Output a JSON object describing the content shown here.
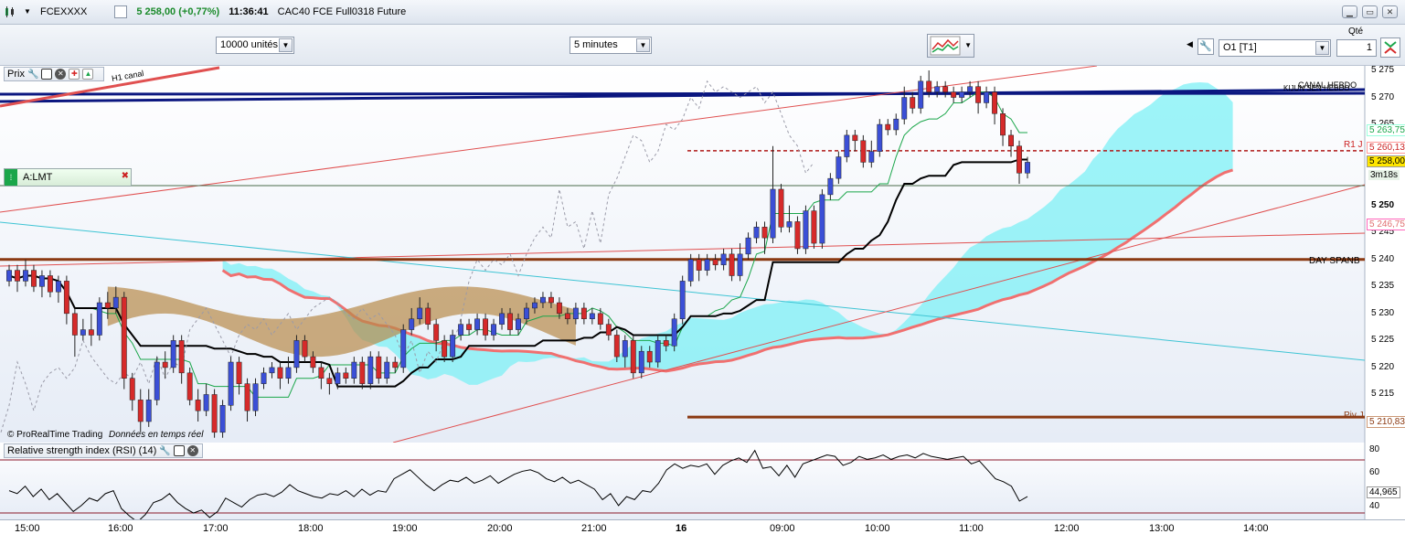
{
  "window": {
    "ticker": "FCEXXXX",
    "price_change": "5 258,00 (+0,77%)",
    "time": "11:36:41",
    "instrument": "CAC40 FCE Full0318 Future"
  },
  "toolbar": {
    "units_select": "10000 unités",
    "interval_select": "5 minutes",
    "order_select": "O1 [T1]",
    "qty_label": "Qté",
    "qty_value": "1"
  },
  "price_panel": {
    "title": "Prix",
    "alert_label": "A:LMT",
    "watermark_brand": "© ProRealTime Trading",
    "watermark_note": "Données en temps réel",
    "axis_ticks": [
      "5 275",
      "5 270",
      "5 265",
      "5 260",
      "5 255",
      "5 250",
      "5 245",
      "5 240",
      "5 235",
      "5 230",
      "5 225",
      "5 220",
      "5 215",
      "5 210"
    ],
    "line_labels": {
      "h1_canal": "H1 canal",
      "canal_hebdo": "CANAL HEBDO",
      "kijun": "KIJUN SEN HEBDO",
      "r1": "R1 J",
      "day_spanb": "DAY SPANB",
      "piv": "Piv J"
    },
    "price_tags": {
      "p1": "5 263,75",
      "p2": "5 260,13",
      "p3": "5 258,00",
      "countdown": "3m18s",
      "p4": "5 246,75",
      "p5": "5 210,83"
    }
  },
  "rsi_panel": {
    "title": "Relative strength index (RSI) (14)",
    "axis_ticks": [
      "80",
      "60",
      "40"
    ],
    "value": "44,965"
  },
  "time_axis": [
    "15:00",
    "16:00",
    "17:00",
    "18:00",
    "19:00",
    "20:00",
    "21:00",
    "16",
    "09:00",
    "10:00",
    "11:00",
    "12:00",
    "13:00",
    "14:00"
  ],
  "colors": {
    "bull": "#3b4fd6",
    "bear": "#d62a2a",
    "cloud": "#7df0f5",
    "cloud_bear": "#b88a4a",
    "tenkan": "#1aa64a",
    "kijun_line": "#000000",
    "canal": "#0b1780",
    "spanb": "#8b3a12"
  },
  "chart_data": {
    "type": "candlestick",
    "ylim": [
      5208,
      5277
    ],
    "candles": [
      {
        "o": 5236,
        "c": 5238,
        "h": 5239,
        "l": 5235
      },
      {
        "o": 5238,
        "c": 5236,
        "h": 5239,
        "l": 5234
      },
      {
        "o": 5236,
        "c": 5238,
        "h": 5240,
        "l": 5235
      },
      {
        "o": 5238,
        "c": 5235,
        "h": 5239,
        "l": 5234
      },
      {
        "o": 5235,
        "c": 5237,
        "h": 5238,
        "l": 5233
      },
      {
        "o": 5237,
        "c": 5234,
        "h": 5238,
        "l": 5233
      },
      {
        "o": 5234,
        "c": 5236,
        "h": 5237,
        "l": 5232
      },
      {
        "o": 5236,
        "c": 5230,
        "h": 5237,
        "l": 5228
      },
      {
        "o": 5230,
        "c": 5226,
        "h": 5231,
        "l": 5222
      },
      {
        "o": 5226,
        "c": 5227,
        "h": 5229,
        "l": 5225
      },
      {
        "o": 5227,
        "c": 5226,
        "h": 5230,
        "l": 5224
      },
      {
        "o": 5226,
        "c": 5232,
        "h": 5233,
        "l": 5225
      },
      {
        "o": 5232,
        "c": 5231,
        "h": 5234,
        "l": 5229
      },
      {
        "o": 5231,
        "c": 5233,
        "h": 5235,
        "l": 5230
      },
      {
        "o": 5233,
        "c": 5218,
        "h": 5234,
        "l": 5216
      },
      {
        "o": 5218,
        "c": 5214,
        "h": 5219,
        "l": 5212
      },
      {
        "o": 5214,
        "c": 5210,
        "h": 5216,
        "l": 5208
      },
      {
        "o": 5210,
        "c": 5214,
        "h": 5216,
        "l": 5209
      },
      {
        "o": 5214,
        "c": 5221,
        "h": 5222,
        "l": 5213
      },
      {
        "o": 5221,
        "c": 5220,
        "h": 5223,
        "l": 5218
      },
      {
        "o": 5220,
        "c": 5225,
        "h": 5226,
        "l": 5219
      },
      {
        "o": 5225,
        "c": 5219,
        "h": 5226,
        "l": 5217
      },
      {
        "o": 5219,
        "c": 5214,
        "h": 5220,
        "l": 5213
      },
      {
        "o": 5214,
        "c": 5212,
        "h": 5216,
        "l": 5210
      },
      {
        "o": 5212,
        "c": 5215,
        "h": 5217,
        "l": 5211
      },
      {
        "o": 5215,
        "c": 5208,
        "h": 5216,
        "l": 5207
      },
      {
        "o": 5208,
        "c": 5213,
        "h": 5214,
        "l": 5207
      },
      {
        "o": 5213,
        "c": 5221,
        "h": 5222,
        "l": 5212
      },
      {
        "o": 5221,
        "c": 5217,
        "h": 5222,
        "l": 5215
      },
      {
        "o": 5217,
        "c": 5212,
        "h": 5218,
        "l": 5210
      },
      {
        "o": 5212,
        "c": 5217,
        "h": 5218,
        "l": 5211
      },
      {
        "o": 5217,
        "c": 5219,
        "h": 5220,
        "l": 5216
      },
      {
        "o": 5219,
        "c": 5220,
        "h": 5221,
        "l": 5218
      },
      {
        "o": 5220,
        "c": 5218,
        "h": 5221,
        "l": 5216
      },
      {
        "o": 5218,
        "c": 5220,
        "h": 5222,
        "l": 5217
      },
      {
        "o": 5220,
        "c": 5225,
        "h": 5226,
        "l": 5219
      },
      {
        "o": 5225,
        "c": 5222,
        "h": 5226,
        "l": 5221
      },
      {
        "o": 5222,
        "c": 5220,
        "h": 5223,
        "l": 5219
      },
      {
        "o": 5220,
        "c": 5218,
        "h": 5221,
        "l": 5216
      },
      {
        "o": 5218,
        "c": 5217,
        "h": 5219,
        "l": 5215
      },
      {
        "o": 5217,
        "c": 5219,
        "h": 5220,
        "l": 5216
      },
      {
        "o": 5219,
        "c": 5218,
        "h": 5220,
        "l": 5217
      },
      {
        "o": 5218,
        "c": 5221,
        "h": 5222,
        "l": 5217
      },
      {
        "o": 5221,
        "c": 5217,
        "h": 5222,
        "l": 5216
      },
      {
        "o": 5217,
        "c": 5222,
        "h": 5223,
        "l": 5216
      },
      {
        "o": 5222,
        "c": 5218,
        "h": 5223,
        "l": 5217
      },
      {
        "o": 5218,
        "c": 5221,
        "h": 5222,
        "l": 5217
      },
      {
        "o": 5221,
        "c": 5220,
        "h": 5222,
        "l": 5219
      },
      {
        "o": 5220,
        "c": 5227,
        "h": 5228,
        "l": 5219
      },
      {
        "o": 5227,
        "c": 5229,
        "h": 5231,
        "l": 5226
      },
      {
        "o": 5229,
        "c": 5231,
        "h": 5233,
        "l": 5228
      },
      {
        "o": 5231,
        "c": 5228,
        "h": 5232,
        "l": 5227
      },
      {
        "o": 5228,
        "c": 5225,
        "h": 5229,
        "l": 5223
      },
      {
        "o": 5225,
        "c": 5222,
        "h": 5226,
        "l": 5221
      },
      {
        "o": 5222,
        "c": 5226,
        "h": 5227,
        "l": 5221
      },
      {
        "o": 5226,
        "c": 5228,
        "h": 5229,
        "l": 5225
      },
      {
        "o": 5228,
        "c": 5227,
        "h": 5229,
        "l": 5226
      },
      {
        "o": 5227,
        "c": 5229,
        "h": 5230,
        "l": 5226
      },
      {
        "o": 5229,
        "c": 5226,
        "h": 5230,
        "l": 5225
      },
      {
        "o": 5226,
        "c": 5228,
        "h": 5229,
        "l": 5225
      },
      {
        "o": 5228,
        "c": 5230,
        "h": 5231,
        "l": 5227
      },
      {
        "o": 5230,
        "c": 5227,
        "h": 5231,
        "l": 5226
      },
      {
        "o": 5227,
        "c": 5229,
        "h": 5230,
        "l": 5226
      },
      {
        "o": 5229,
        "c": 5231,
        "h": 5232,
        "l": 5228
      },
      {
        "o": 5231,
        "c": 5232,
        "h": 5233,
        "l": 5230
      },
      {
        "o": 5232,
        "c": 5233,
        "h": 5234,
        "l": 5231
      },
      {
        "o": 5233,
        "c": 5232,
        "h": 5234,
        "l": 5231
      },
      {
        "o": 5232,
        "c": 5230,
        "h": 5233,
        "l": 5229
      },
      {
        "o": 5230,
        "c": 5229,
        "h": 5231,
        "l": 5228
      },
      {
        "o": 5229,
        "c": 5231,
        "h": 5232,
        "l": 5228
      },
      {
        "o": 5231,
        "c": 5229,
        "h": 5232,
        "l": 5228
      },
      {
        "o": 5229,
        "c": 5230,
        "h": 5231,
        "l": 5228
      },
      {
        "o": 5230,
        "c": 5228,
        "h": 5231,
        "l": 5227
      },
      {
        "o": 5228,
        "c": 5226,
        "h": 5229,
        "l": 5225
      },
      {
        "o": 5226,
        "c": 5222,
        "h": 5227,
        "l": 5221
      },
      {
        "o": 5222,
        "c": 5225,
        "h": 5226,
        "l": 5220
      },
      {
        "o": 5225,
        "c": 5219,
        "h": 5226,
        "l": 5218
      },
      {
        "o": 5219,
        "c": 5223,
        "h": 5224,
        "l": 5218
      },
      {
        "o": 5223,
        "c": 5221,
        "h": 5224,
        "l": 5220
      },
      {
        "o": 5221,
        "c": 5225,
        "h": 5226,
        "l": 5220
      },
      {
        "o": 5225,
        "c": 5224,
        "h": 5226,
        "l": 5223
      },
      {
        "o": 5224,
        "c": 5229,
        "h": 5230,
        "l": 5223
      },
      {
        "o": 5229,
        "c": 5236,
        "h": 5237,
        "l": 5228
      },
      {
        "o": 5236,
        "c": 5240,
        "h": 5241,
        "l": 5235
      },
      {
        "o": 5240,
        "c": 5238,
        "h": 5241,
        "l": 5236
      },
      {
        "o": 5238,
        "c": 5240,
        "h": 5241,
        "l": 5237
      },
      {
        "o": 5240,
        "c": 5239,
        "h": 5241,
        "l": 5238
      },
      {
        "o": 5239,
        "c": 5241,
        "h": 5242,
        "l": 5238
      },
      {
        "o": 5241,
        "c": 5237,
        "h": 5242,
        "l": 5236
      },
      {
        "o": 5237,
        "c": 5241,
        "h": 5243,
        "l": 5236
      },
      {
        "o": 5241,
        "c": 5244,
        "h": 5245,
        "l": 5240
      },
      {
        "o": 5244,
        "c": 5246,
        "h": 5247,
        "l": 5243
      },
      {
        "o": 5246,
        "c": 5244,
        "h": 5247,
        "l": 5241
      },
      {
        "o": 5244,
        "c": 5253,
        "h": 5261,
        "l": 5243
      },
      {
        "o": 5253,
        "c": 5246,
        "h": 5254,
        "l": 5245
      },
      {
        "o": 5246,
        "c": 5247,
        "h": 5250,
        "l": 5245
      },
      {
        "o": 5247,
        "c": 5242,
        "h": 5248,
        "l": 5241
      },
      {
        "o": 5242,
        "c": 5249,
        "h": 5250,
        "l": 5241
      },
      {
        "o": 5249,
        "c": 5243,
        "h": 5250,
        "l": 5242
      },
      {
        "o": 5243,
        "c": 5252,
        "h": 5253,
        "l": 5242
      },
      {
        "o": 5252,
        "c": 5255,
        "h": 5256,
        "l": 5251
      },
      {
        "o": 5255,
        "c": 5259,
        "h": 5260,
        "l": 5254
      },
      {
        "o": 5259,
        "c": 5263,
        "h": 5264,
        "l": 5258
      },
      {
        "o": 5263,
        "c": 5262,
        "h": 5264,
        "l": 5260
      },
      {
        "o": 5262,
        "c": 5258,
        "h": 5263,
        "l": 5257
      },
      {
        "o": 5258,
        "c": 5260,
        "h": 5262,
        "l": 5257
      },
      {
        "o": 5260,
        "c": 5265,
        "h": 5266,
        "l": 5259
      },
      {
        "o": 5265,
        "c": 5264,
        "h": 5266,
        "l": 5263
      },
      {
        "o": 5264,
        "c": 5266,
        "h": 5267,
        "l": 5263
      },
      {
        "o": 5266,
        "c": 5270,
        "h": 5272,
        "l": 5265
      },
      {
        "o": 5270,
        "c": 5268,
        "h": 5271,
        "l": 5267
      },
      {
        "o": 5268,
        "c": 5273,
        "h": 5274,
        "l": 5267
      },
      {
        "o": 5273,
        "c": 5271,
        "h": 5275,
        "l": 5270
      },
      {
        "o": 5271,
        "c": 5272,
        "h": 5273,
        "l": 5270
      },
      {
        "o": 5272,
        "c": 5271,
        "h": 5273,
        "l": 5270
      },
      {
        "o": 5271,
        "c": 5270,
        "h": 5272,
        "l": 5269
      },
      {
        "o": 5270,
        "c": 5271,
        "h": 5272,
        "l": 5269
      },
      {
        "o": 5271,
        "c": 5272,
        "h": 5273,
        "l": 5270
      },
      {
        "o": 5272,
        "c": 5269,
        "h": 5273,
        "l": 5267
      },
      {
        "o": 5269,
        "c": 5271,
        "h": 5272,
        "l": 5268
      },
      {
        "o": 5271,
        "c": 5267,
        "h": 5272,
        "l": 5265
      },
      {
        "o": 5267,
        "c": 5263,
        "h": 5268,
        "l": 5261
      },
      {
        "o": 5263,
        "c": 5261,
        "h": 5264,
        "l": 5259
      },
      {
        "o": 5261,
        "c": 5256,
        "h": 5262,
        "l": 5254
      },
      {
        "o": 5256,
        "c": 5258,
        "h": 5259,
        "l": 5255
      }
    ],
    "rsi": [
      52,
      50,
      55,
      48,
      53,
      46,
      50,
      44,
      38,
      42,
      47,
      45,
      50,
      52,
      40,
      35,
      31,
      36,
      44,
      46,
      50,
      44,
      40,
      37,
      39,
      34,
      38,
      47,
      44,
      41,
      46,
      49,
      50,
      48,
      51,
      56,
      52,
      50,
      48,
      47,
      50,
      49,
      52,
      48,
      53,
      49,
      52,
      51,
      60,
      63,
      66,
      61,
      56,
      52,
      56,
      59,
      58,
      61,
      57,
      59,
      62,
      57,
      60,
      63,
      65,
      66,
      64,
      60,
      58,
      61,
      57,
      59,
      56,
      53,
      46,
      50,
      42,
      48,
      46,
      52,
      51,
      57,
      66,
      70,
      67,
      69,
      68,
      70,
      63,
      69,
      72,
      74,
      71,
      79,
      67,
      68,
      62,
      69,
      61,
      70,
      72,
      74,
      76,
      75,
      69,
      71,
      75,
      73,
      74,
      76,
      73,
      75,
      76,
      74,
      77,
      75,
      74,
      73,
      74,
      75,
      70,
      72,
      66,
      60,
      58,
      55,
      45,
      48
    ]
  }
}
